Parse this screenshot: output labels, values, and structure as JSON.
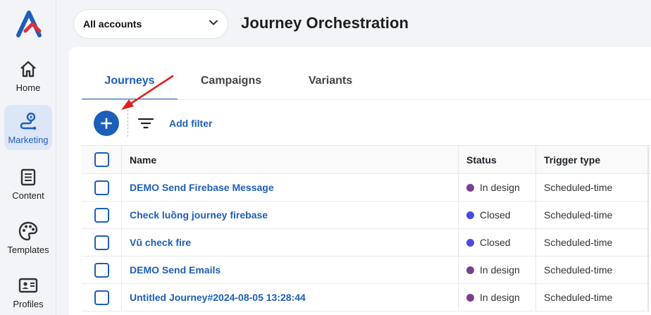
{
  "sidebar": {
    "items": [
      {
        "label": "Home",
        "icon": "home-icon"
      },
      {
        "label": "Marketing",
        "icon": "marketing-route-icon",
        "active": true
      },
      {
        "label": "Content",
        "icon": "document-icon"
      },
      {
        "label": "Templates",
        "icon": "palette-icon"
      },
      {
        "label": "Profiles",
        "icon": "id-card-icon"
      }
    ]
  },
  "header": {
    "account_select": "All accounts",
    "title": "Journey Orchestration"
  },
  "tabs": [
    {
      "label": "Journeys",
      "active": true
    },
    {
      "label": "Campaigns"
    },
    {
      "label": "Variants"
    }
  ],
  "toolbar": {
    "add_filter_label": "Add filter"
  },
  "table": {
    "columns": [
      "Name",
      "Status",
      "Trigger type"
    ],
    "rows": [
      {
        "name": "DEMO Send Firebase Message",
        "status": "In design",
        "status_color": "#7b3f8f",
        "trigger": "Scheduled-time"
      },
      {
        "name": "Check luồng journey firebase",
        "status": "Closed",
        "status_color": "#4a4ae8",
        "trigger": "Scheduled-time"
      },
      {
        "name": "Vũ check fire",
        "status": "Closed",
        "status_color": "#4a4ae8",
        "trigger": "Scheduled-time"
      },
      {
        "name": "DEMO Send Emails",
        "status": "In design",
        "status_color": "#7b3f8f",
        "trigger": "Scheduled-time"
      },
      {
        "name": "Untitled Journey#2024-08-05 13:28:44",
        "status": "In design",
        "status_color": "#7b3f8f",
        "trigger": "Scheduled-time"
      }
    ]
  },
  "colors": {
    "accent": "#1d5fb8",
    "annotation_arrow": "#e02020"
  }
}
